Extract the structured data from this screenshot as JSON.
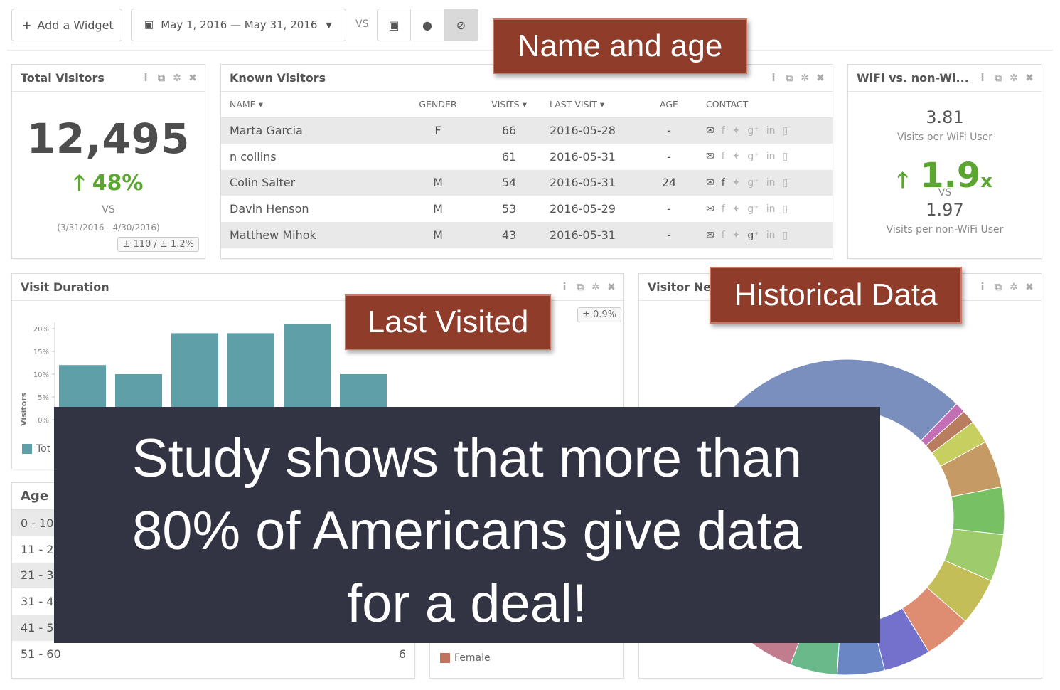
{
  "toolbar": {
    "add_widget": "Add a Widget",
    "date_range": "May 1, 2016 — May 31, 2016",
    "vs": "VS"
  },
  "widgets": {
    "total_visitors": {
      "title": "Total Visitors",
      "count": "12,495",
      "change": "48%",
      "vs": "VS",
      "range": "(3/31/2016 - 4/30/2016)",
      "margin": "± 110 / ± 1.2%"
    },
    "known_visitors": {
      "title": "Known Visitors",
      "columns": [
        "NAME",
        "GENDER",
        "VISITS",
        "LAST VISIT",
        "AGE",
        "CONTACT"
      ],
      "rows": [
        {
          "name": "Marta Garcia",
          "gender": "F",
          "visits": "66",
          "last": "2016-05-28",
          "age": "-"
        },
        {
          "name": "n collins",
          "gender": "",
          "visits": "61",
          "last": "2016-05-31",
          "age": "-"
        },
        {
          "name": "Colin Salter",
          "gender": "M",
          "visits": "54",
          "last": "2016-05-31",
          "age": "24"
        },
        {
          "name": "Davin Henson",
          "gender": "M",
          "visits": "53",
          "last": "2016-05-29",
          "age": "-"
        },
        {
          "name": "Matthew Mihok",
          "gender": "M",
          "visits": "43",
          "last": "2016-05-31",
          "age": "-"
        }
      ]
    },
    "wifi": {
      "title": "WiFi vs. non-Wi...",
      "wifi_value": "3.81",
      "wifi_label": "Visits per WiFi User",
      "ratio": "1.9",
      "ratio_unit": "x",
      "vs": "VS",
      "nonwifi_value": "1.97",
      "nonwifi_label": "Visits per non-WiFi User"
    },
    "visit_duration": {
      "title": "Visit Duration",
      "ylabel": "Visitors",
      "ticks": [
        "20%",
        "15%",
        "10%",
        "5%",
        "0%"
      ],
      "legend": "Tot",
      "badge": "± 0.9%"
    },
    "visitor_network": {
      "title": "Visitor Ne"
    },
    "age": {
      "title": "Age",
      "rows": [
        {
          "label": "0 - 10",
          "value": ""
        },
        {
          "label": "11 - 2",
          "value": ""
        },
        {
          "label": "21 - 3",
          "value": ""
        },
        {
          "label": "31 - 4",
          "value": ""
        },
        {
          "label": "41 - 5",
          "value": ""
        },
        {
          "label": "51 - 60",
          "value": "6"
        }
      ]
    },
    "gender": {
      "legend_female": "Female"
    }
  },
  "chart_data": [
    {
      "type": "bar",
      "title": "Visit Duration",
      "ylabel": "Visitors",
      "ylim": [
        0,
        0.2
      ],
      "values": [
        0.12,
        0.1,
        0.19,
        0.19,
        0.21,
        0.1
      ]
    },
    {
      "type": "pie",
      "title": "Visitor Ne",
      "values": [
        30,
        1,
        1.3,
        2.2,
        4.5,
        4.5,
        4.5,
        4.5,
        4.5,
        4.5,
        4.5,
        4.5,
        4.5,
        4.5,
        4.5,
        4.5,
        4.5
      ],
      "colors": [
        "#7a8fbd",
        "#c26fb5",
        "#b87c5f",
        "#c6cf5f",
        "#c69a65",
        "#77c064",
        "#9ecb6b",
        "#c3be57",
        "#de8d73",
        "#7371cc",
        "#6b86c4",
        "#69b98a",
        "#c17c8d",
        "#62b69d",
        "#8f6fc3",
        "#99b062",
        "#b9b25f"
      ]
    }
  ],
  "callouts": {
    "name_age": "Name and age",
    "last_visited": "Last Visited",
    "historical": "Historical Data"
  },
  "banner": {
    "line1": "Study shows that more than",
    "line2": "80% of Americans give data",
    "line3": "for a deal!"
  }
}
